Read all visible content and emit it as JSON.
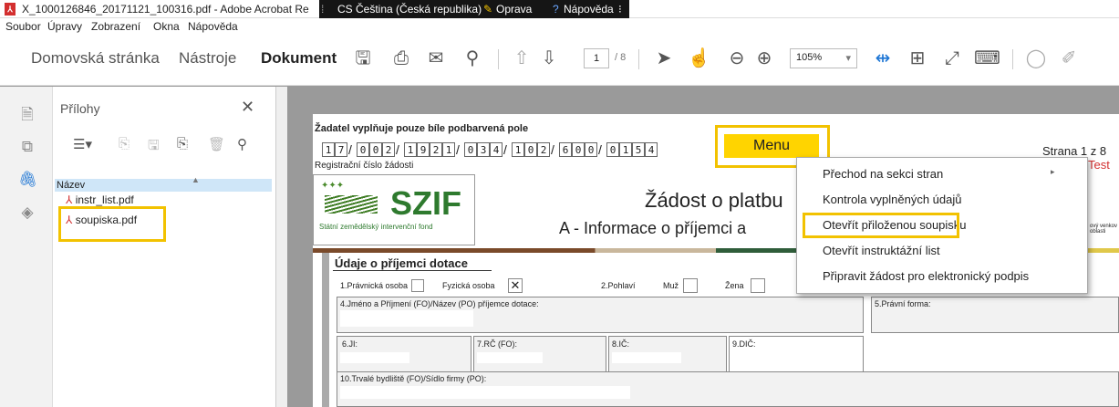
{
  "window": {
    "title": "X_1000126846_20171121_100316.pdf - Adobe Acrobat Re",
    "lang_label": "CS Čeština (Česká republika)",
    "repair_label": "Oprava",
    "help_label": "Nápověda"
  },
  "menubar": [
    "Soubor",
    "Úpravy",
    "Zobrazení",
    "Okna",
    "Nápověda"
  ],
  "toolbar": {
    "tabs": [
      "Domovská stránka",
      "Nástroje",
      "Dokument"
    ],
    "active_tab": "Dokument",
    "current_page": "1",
    "total_pages": "/ 8",
    "zoom": "105%"
  },
  "attachments": {
    "title": "Přílohy",
    "column_header": "Název",
    "files": [
      "instr_list.pdf",
      "soupiska.pdf"
    ]
  },
  "document": {
    "notice": "Žadatel vyplňuje pouze bíle podbarvená pole",
    "reg_digits": [
      "1",
      "7",
      "0",
      "0",
      "2",
      "1",
      "9",
      "2",
      "1",
      "0",
      "3",
      "4",
      "1",
      "0",
      "2",
      "6",
      "0",
      "0",
      "0",
      "1",
      "5",
      "4"
    ],
    "reg_label": "Registrační číslo žádosti",
    "menu_button": "Menu",
    "page_info": "Strana 1 z 8",
    "test_label": "Test",
    "logo_text": "SZIF",
    "logo_subtitle": "Státní zemědělský intervenční fond",
    "heading_1": "Žádost o platbu",
    "heading_2": "A - Informace o příjemci a",
    "side_note": "ový venkov\noblasti",
    "section_title": "Údaje o příjemci dotace",
    "legal_person": "1.Právnická osoba",
    "natural_person": "Fyzická osoba",
    "gender": "2.Pohlaví",
    "male": "Muž",
    "female": "Žena",
    "name_field": "4.Jméno a Příjmení (FO)/Název (PO) příjemce dotace:",
    "legal_form": "5.Právní forma:",
    "ji": "6.JI:",
    "rc": "7.RČ (FO):",
    "ic": "8.IČ:",
    "dic": "9.DIČ:",
    "address": "10.Trvalé bydliště (FO)/Sídlo firmy (PO):"
  },
  "context_menu": {
    "items": [
      "Přechod na sekci stran",
      "Kontrola vyplněných údajů",
      "Otevřít přiloženou soupisku",
      "Otevřít instruktážní list",
      "Připravit žádost pro elektronický podpis"
    ]
  },
  "colors": {
    "highlight": "#f2c200",
    "menu_button_bg": "#ffd400",
    "test": "#d32f2f"
  }
}
